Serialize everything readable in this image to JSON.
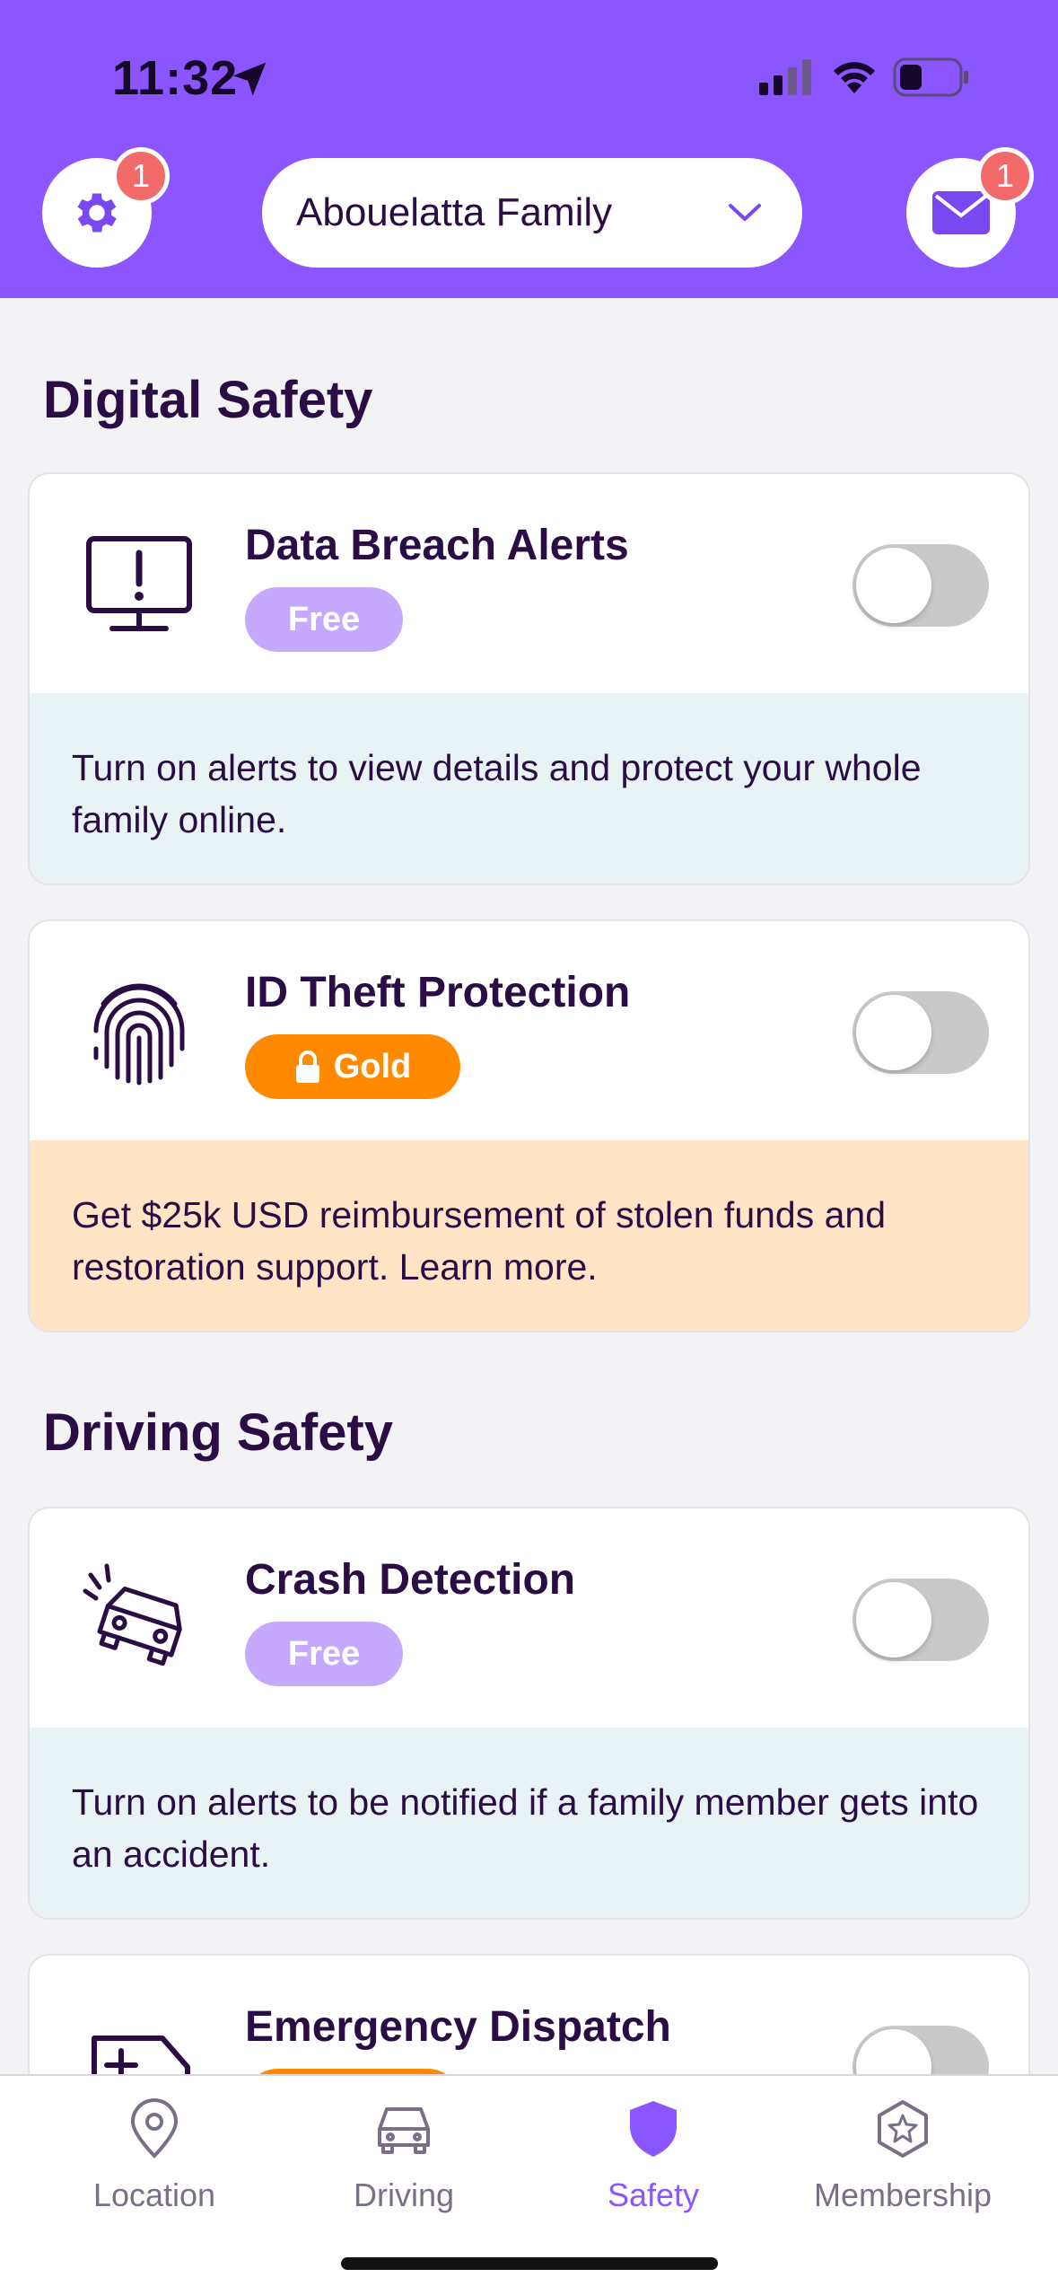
{
  "status": {
    "time": "11:32"
  },
  "header": {
    "settings_badge": "1",
    "family_name": "Abouelatta Family",
    "inbox_badge": "1"
  },
  "sections": [
    {
      "title": "Digital Safety",
      "cards": [
        {
          "title": "Data Breach Alerts",
          "tier": "Free",
          "enabled": false,
          "description": "Turn on alerts to view details and protect your whole family online."
        },
        {
          "title": "ID Theft Protection",
          "tier": "Gold",
          "enabled": false,
          "description": "Get $25k USD reimbursement of stolen funds and restoration support. Learn more."
        }
      ]
    },
    {
      "title": "Driving Safety",
      "cards": [
        {
          "title": "Crash Detection",
          "tier": "Free",
          "enabled": false,
          "description": "Turn on alerts to be notified if a family member gets into an accident."
        },
        {
          "title": "Emergency Dispatch",
          "enabled": false
        }
      ]
    }
  ],
  "tabs": [
    {
      "label": "Location",
      "icon": "location-pin-icon"
    },
    {
      "label": "Driving",
      "icon": "car-icon"
    },
    {
      "label": "Safety",
      "icon": "shield-icon",
      "active": true
    },
    {
      "label": "Membership",
      "icon": "star-badge-icon"
    }
  ],
  "colors": {
    "brand": "#8b55ff",
    "text": "#2a0d45",
    "free_pill": "#c4a9ff",
    "gold_pill": "#ff8a00",
    "info_blue": "#e9f3f5",
    "info_peach": "#ffe4c6",
    "badge": "#f26a6a"
  }
}
